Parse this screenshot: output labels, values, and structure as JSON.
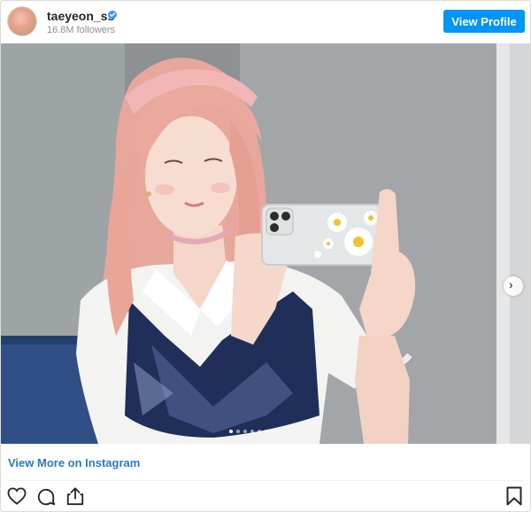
{
  "header": {
    "username": "taeyeon_ss",
    "followers": "16.8M followers",
    "view_profile_label": "View Profile",
    "verified_color": "#3897f0",
    "button_color": "#0095f6"
  },
  "photo": {
    "carousel_count": 8,
    "carousel_active": 1,
    "next_icon": "chevron-right-icon"
  },
  "footer": {
    "view_more_label": "View More on Instagram",
    "icons": [
      "heart-icon",
      "comment-icon",
      "share-icon",
      "bookmark-icon"
    ]
  }
}
